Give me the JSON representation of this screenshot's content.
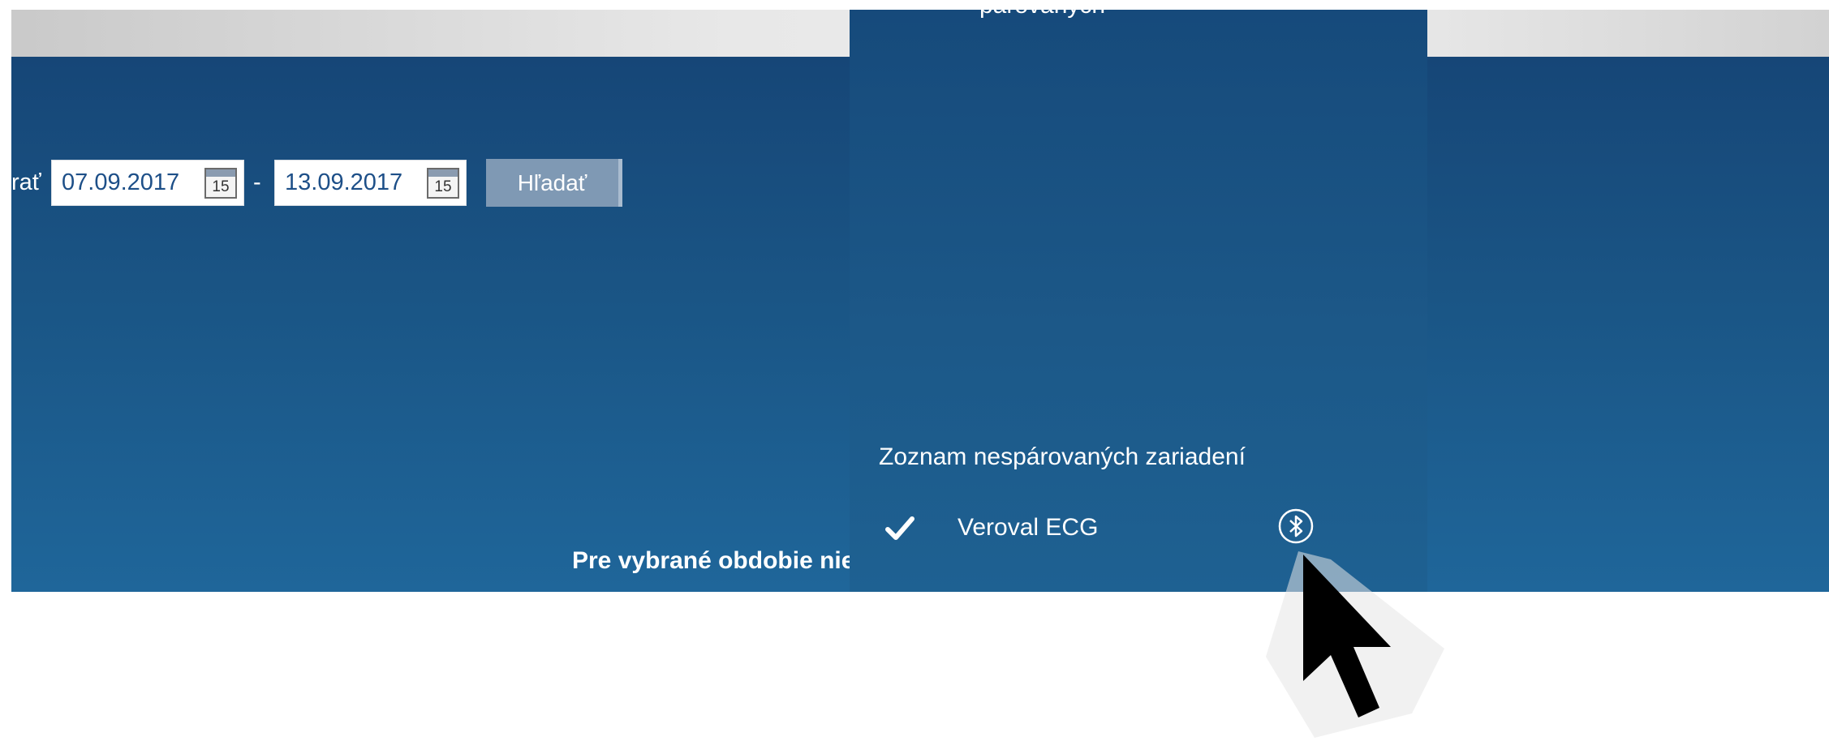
{
  "search_bar": {
    "label_partial": "rať",
    "date_from": "07.09.2017",
    "date_to": "13.09.2017",
    "calendar_day": "15",
    "range_separator": "-",
    "search_button_label": "Hľadať"
  },
  "main": {
    "no_data_text_partial": "Pre vybrané obdobie nie"
  },
  "device_panel": {
    "top_text_partial": "párovaných",
    "title": "Zoznam nespárovaných zariadení",
    "devices": [
      {
        "name": "Veroval ECG",
        "selected": true,
        "icon": "bluetooth-icon"
      }
    ]
  },
  "colors": {
    "band_top": "#164677",
    "band_bottom": "#1f669a",
    "button": "#7f99b4",
    "date_text": "#1d4f88"
  }
}
